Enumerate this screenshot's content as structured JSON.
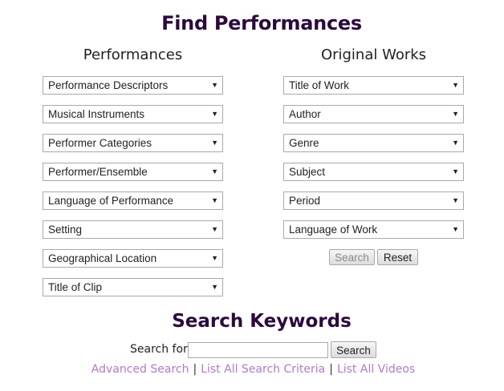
{
  "title": "Find Performances",
  "performances": {
    "heading": "Performances",
    "dropdowns": [
      "Performance Descriptors",
      "Musical Instruments",
      "Performer Categories",
      "Performer/Ensemble",
      "Language of Performance",
      "Setting",
      "Geographical Location",
      "Title of Clip"
    ]
  },
  "works": {
    "heading": "Original Works",
    "dropdowns": [
      "Title of Work",
      "Author",
      "Genre",
      "Subject",
      "Period",
      "Language of Work"
    ],
    "search_label": "Search",
    "reset_label": "Reset"
  },
  "keywords": {
    "heading": "Search Keywords",
    "search_for_label": "Search for:",
    "input_value": "",
    "button_label": "Search"
  },
  "links": [
    "Advanced Search",
    "List All Search Criteria",
    "List All Videos"
  ],
  "caret_glyph": "▼",
  "separator": "|",
  "colors": {
    "heading": "#2b0a3d",
    "link": "#b07acb"
  }
}
